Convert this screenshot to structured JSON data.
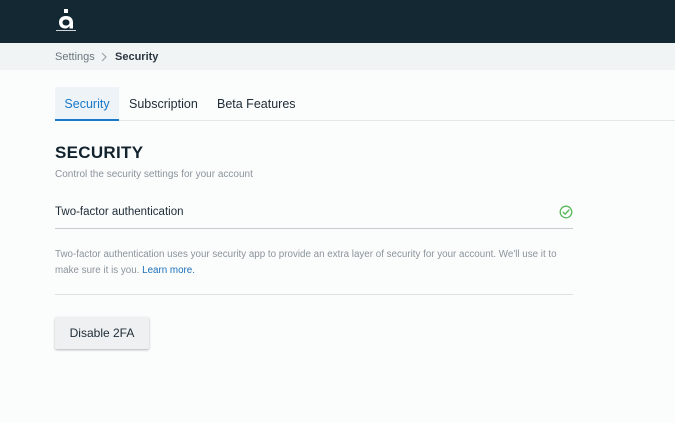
{
  "header": {
    "logo_icon": "app-logo-icon"
  },
  "breadcrumb": {
    "root": "Settings",
    "separator_icon": "chevron-right-icon",
    "current": "Security"
  },
  "tabs": [
    {
      "label": "Security",
      "active": true
    },
    {
      "label": "Subscription",
      "active": false
    },
    {
      "label": "Beta Features",
      "active": false
    }
  ],
  "security": {
    "title": "SECURITY",
    "subtitle": "Control the security settings for your account",
    "two_factor": {
      "label": "Two-factor authentication",
      "status_icon": "check-circle-icon",
      "status_color": "#5cb85c"
    },
    "description": "Two-factor authentication uses your security app to provide an extra layer of security for your account. We'll use it to make sure it is you.",
    "learn_more": "Learn more.",
    "disable_button": "Disable 2FA"
  },
  "colors": {
    "header_bg": "#132833",
    "accent": "#1a78c8",
    "success": "#5cb85c"
  }
}
